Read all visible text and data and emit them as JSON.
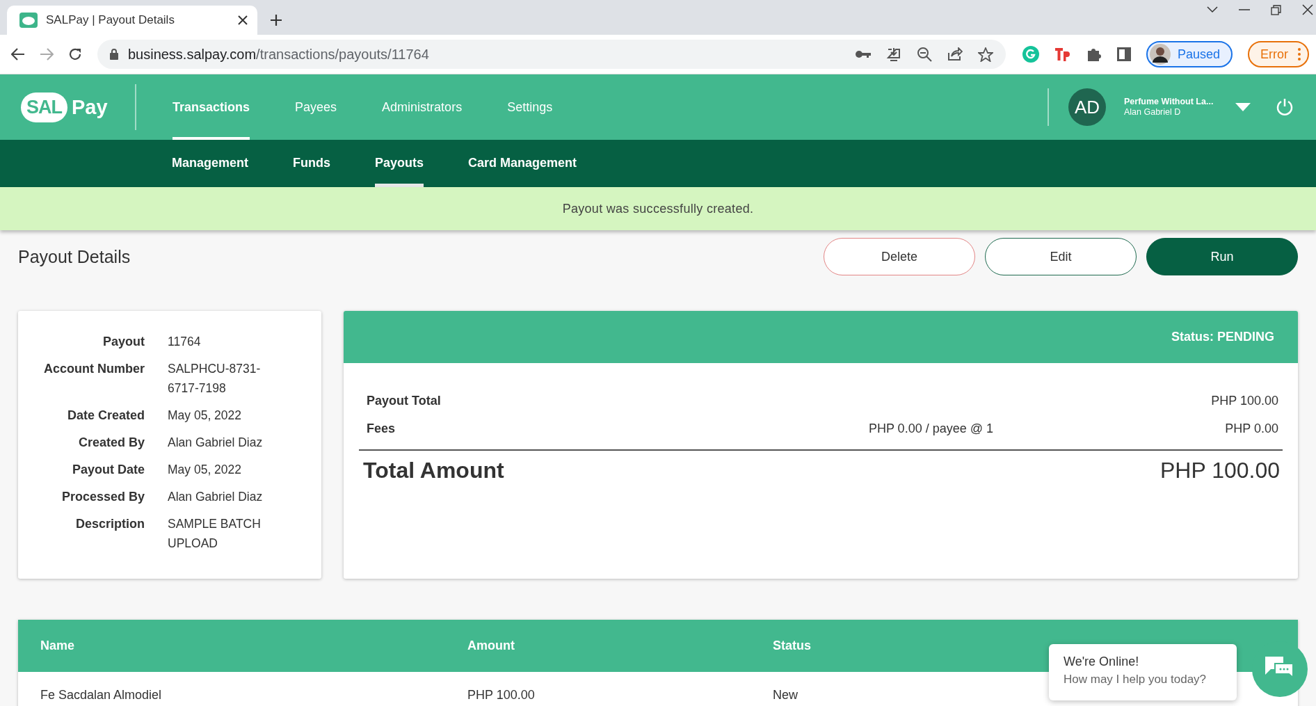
{
  "browser": {
    "tab_title": "SALPay | Payout Details",
    "url_host": "business.salpay.com",
    "url_path": "/transactions/payouts/11764",
    "profile_label": "Paused",
    "error_label": "Error"
  },
  "header": {
    "logo": [
      "SAL",
      "Pay"
    ],
    "nav": [
      {
        "label": "Transactions",
        "selected": true
      },
      {
        "label": "Payees",
        "selected": false
      },
      {
        "label": "Administrators",
        "selected": false
      },
      {
        "label": "Settings",
        "selected": false
      }
    ],
    "account": {
      "initials": "AD",
      "company": "Perfume Without La...",
      "user": "Alan Gabriel D"
    }
  },
  "subnav": [
    {
      "label": "Management",
      "selected": false
    },
    {
      "label": "Funds",
      "selected": false
    },
    {
      "label": "Payouts",
      "selected": true
    },
    {
      "label": "Card Management",
      "selected": false
    }
  ],
  "banner": "Payout was successfully created.",
  "page_title": "Payout Details",
  "actions": [
    {
      "kind": "danger",
      "label": "Delete"
    },
    {
      "kind": "outline",
      "label": "Edit"
    },
    {
      "kind": "primary",
      "label": "Run"
    }
  ],
  "details": [
    {
      "label": "Payout",
      "value": "11764"
    },
    {
      "label": "Account Number",
      "value": "SALPHCU-8731-6717-7198"
    },
    {
      "label": "Date Created",
      "value": "May 05, 2022"
    },
    {
      "label": "Created By",
      "value": "Alan Gabriel Diaz"
    },
    {
      "label": "Payout Date",
      "value": "May 05, 2022"
    },
    {
      "label": "Processed By",
      "value": "Alan Gabriel Diaz"
    },
    {
      "label": "Description",
      "value": "SAMPLE BATCH UPLOAD"
    }
  ],
  "summary": {
    "status": "Status: PENDING",
    "rows": [
      {
        "label": "Payout Total",
        "amount": "PHP 100.00"
      },
      {
        "label": "Fees",
        "note": "PHP 0.00 / payee @ 1",
        "amount": "PHP 0.00"
      }
    ],
    "total_label": "Total Amount",
    "total_amount": "PHP 100.00"
  },
  "table": {
    "columns": [
      "Name",
      "Amount",
      "Status"
    ],
    "rows": [
      [
        "Fe Sacdalan Almodiel",
        "PHP 100.00",
        "New"
      ]
    ]
  },
  "chat": {
    "title": "We're Online!",
    "message": "How may I help you today?"
  }
}
